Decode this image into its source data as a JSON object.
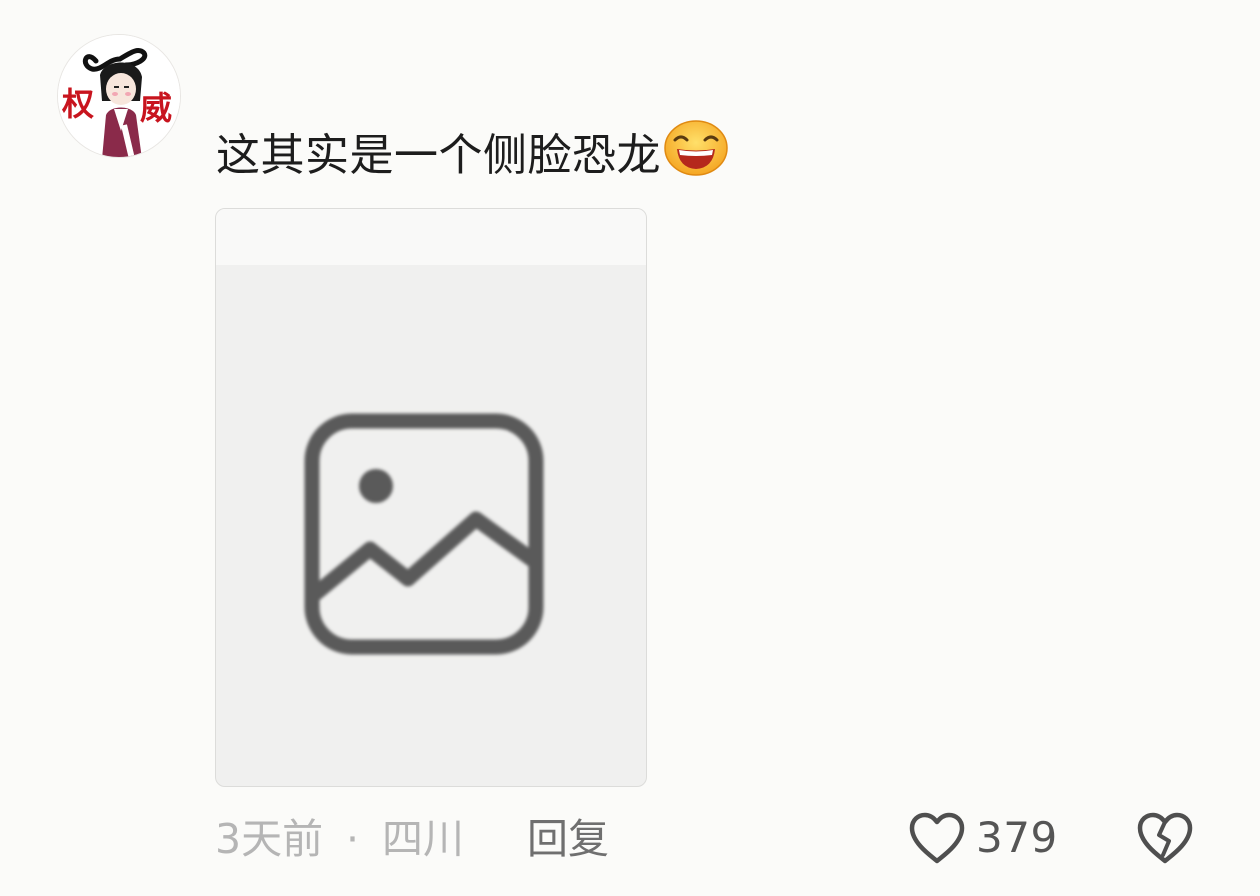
{
  "comment": {
    "text": "这其实是一个侧脸恐龙",
    "emoji": "grinning-face-emoji",
    "avatar": {
      "label_left": "权",
      "label_right": "威"
    },
    "attachment": {
      "icon": "image-placeholder-icon"
    }
  },
  "meta": {
    "time": "3天前",
    "separator": "·",
    "location": "四川",
    "reply_label": "回复"
  },
  "actions": {
    "like_icon": "heart-outline-icon",
    "like_count": "379",
    "dislike_icon": "broken-heart-icon"
  },
  "colors": {
    "background": "#fbfbf9",
    "text": "#1d1d1d",
    "meta": "#b5b5b5",
    "reply": "#6f6f6f",
    "icon": "#555555",
    "avatar_accent": "#c8141e"
  }
}
